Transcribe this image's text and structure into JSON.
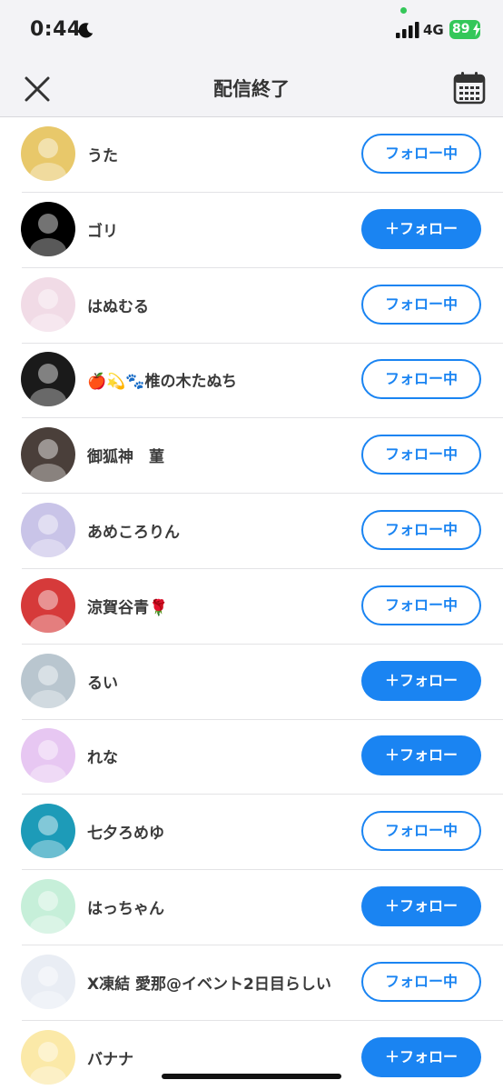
{
  "status_bar": {
    "time": "0:44",
    "network": "4G",
    "battery": "89"
  },
  "header": {
    "title": "配信終了",
    "close_icon": "close-icon",
    "calendar_icon": "calendar-icon"
  },
  "users": [
    {
      "name": "うた",
      "button": "フォロー中",
      "following": true,
      "avatar_color": "#e8c86a"
    },
    {
      "name": "ゴリ",
      "button": "＋フォロー",
      "following": false,
      "avatar_color": "#000000"
    },
    {
      "name": "はぬむる",
      "button": "フォロー中",
      "following": true,
      "avatar_color": "#f1dbe6"
    },
    {
      "name": "🍎💫🐾椎の木たぬち",
      "button": "フォロー中",
      "following": true,
      "avatar_color": "#1a1a1a"
    },
    {
      "name": "御狐神　菫",
      "button": "フォロー中",
      "following": true,
      "avatar_color": "#4a3f3a"
    },
    {
      "name": "あめころりん",
      "button": "フォロー中",
      "following": true,
      "avatar_color": "#c9c4e8"
    },
    {
      "name": "涼賀谷青🌹",
      "button": "フォロー中",
      "following": true,
      "avatar_color": "#d63a3a"
    },
    {
      "name": "るい",
      "button": "＋フォロー",
      "following": false,
      "avatar_color": "#b9c6cf"
    },
    {
      "name": "れな",
      "button": "＋フォロー",
      "following": false,
      "avatar_color": "#e7c7f2"
    },
    {
      "name": "七夕ろめゆ",
      "button": "フォロー中",
      "following": true,
      "avatar_color": "#1d9bb8"
    },
    {
      "name": "はっちゃん",
      "button": "＋フォロー",
      "following": false,
      "avatar_color": "#c6efd9"
    },
    {
      "name": "X凍結 愛那@イベント2日目らしい",
      "button": "フォロー中",
      "following": true,
      "avatar_color": "#e9edf4"
    },
    {
      "name": "バナナ",
      "button": "＋フォロー",
      "following": false,
      "avatar_color": "#fbe9a8"
    }
  ]
}
